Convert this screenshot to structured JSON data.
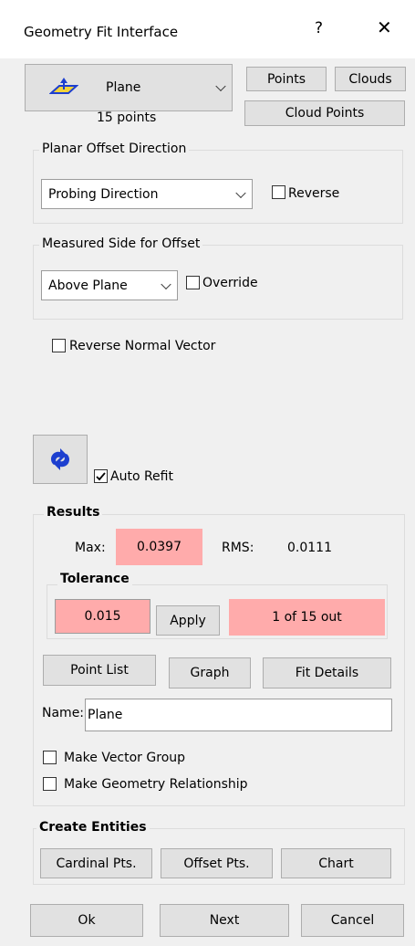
{
  "window": {
    "title": "Geometry Fit Interface",
    "help_glyph": "?",
    "close_glyph": "✕"
  },
  "top": {
    "type_select": "Plane",
    "type_icon": "plane-icon",
    "points_button": "Points",
    "clouds_button": "Clouds",
    "cloud_points_button": "Cloud Points",
    "point_count": "15 points"
  },
  "planar_offset": {
    "label": "Planar Offset Direction",
    "direction_select": "Probing Direction",
    "reverse_label": "Reverse",
    "reverse_checked": false
  },
  "measured_side": {
    "label": "Measured Side for Offset",
    "side_select": "Above Plane",
    "override_label": "Override",
    "override_checked": false
  },
  "reverse_normal": {
    "label": "Reverse Normal Vector",
    "checked": false
  },
  "refit": {
    "icon": "refresh-icon",
    "auto_refit_label": "Auto Refit",
    "auto_refit_checked": true
  },
  "results": {
    "label": "Results",
    "max_label": "Max:",
    "max_value": "0.0397",
    "rms_label": "RMS:",
    "rms_value": "0.0111",
    "tolerance": {
      "label": "Tolerance",
      "value": "0.015",
      "apply_button": "Apply",
      "out_status": "1 of 15 out"
    },
    "point_list_button": "Point List",
    "graph_button": "Graph",
    "fit_details_button": "Fit Details",
    "name_label": "Name:",
    "name_value": "Plane",
    "make_vector_group": "Make Vector Group",
    "make_geometry_relationship": "Make Geometry Relationship"
  },
  "create_entities": {
    "label": "Create Entities",
    "cardinal_button": "Cardinal Pts.",
    "offset_button": "Offset Pts.",
    "chart_button": "Chart"
  },
  "footer": {
    "ok_button": "Ok",
    "next_button": "Next",
    "cancel_button": "Cancel"
  },
  "colors": {
    "alert_pink": "#ffabab",
    "icon_blue": "#1d3fcf",
    "background": "#f0f0f0"
  }
}
